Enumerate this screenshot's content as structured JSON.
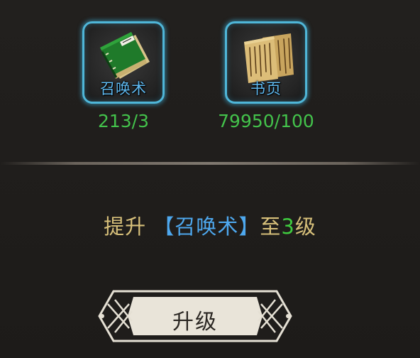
{
  "items": [
    {
      "name": "召唤术",
      "count": "213/3",
      "icon": "green-book-icon"
    },
    {
      "name": "书页",
      "count": "79950/100",
      "icon": "scroll-pages-icon"
    }
  ],
  "upgrade": {
    "prefix": "提升",
    "skill": "【召唤术】",
    "middle": "至",
    "level": "3",
    "suffix": "级"
  },
  "button": {
    "label": "升级"
  },
  "colors": {
    "slot_border": "#4fb6d8",
    "item_name": "#5fb9f0",
    "count": "#43c24b",
    "text_gold": "#d7c07a",
    "skill_blue": "#4ea8ee",
    "level_green": "#3fcb3f",
    "button_fill": "#e9e4d9"
  }
}
